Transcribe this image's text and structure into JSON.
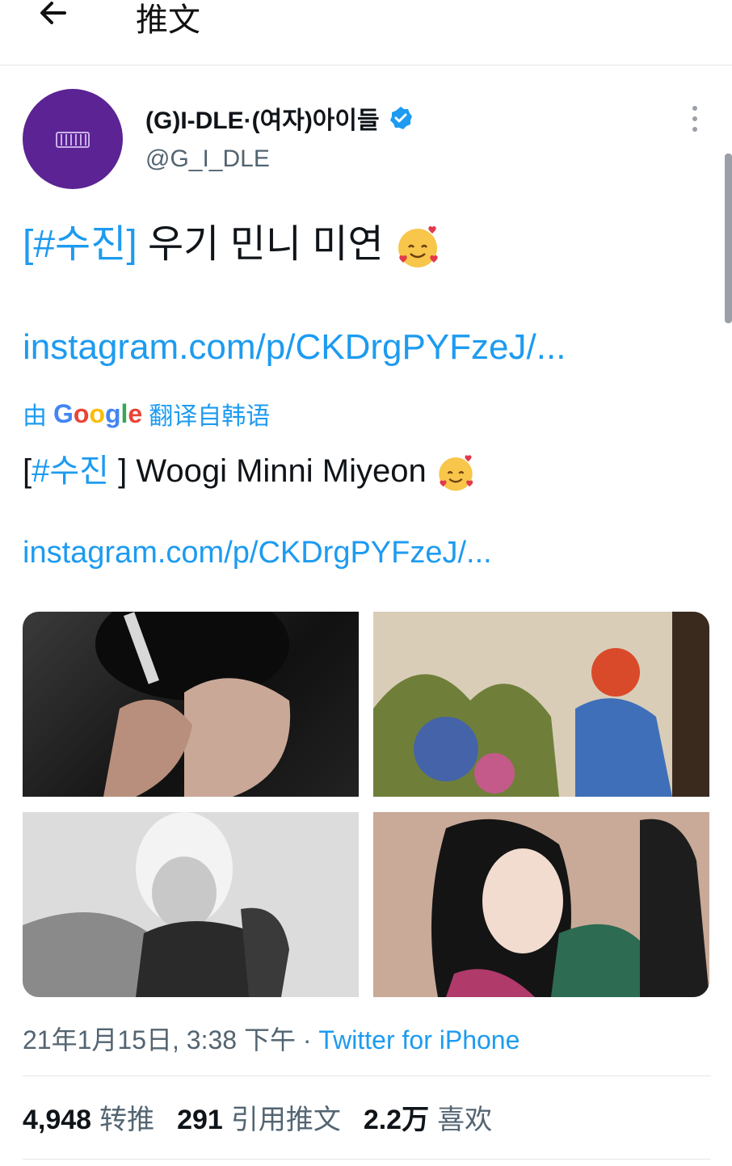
{
  "header": {
    "title": "推文"
  },
  "author": {
    "name": "(G)I-DLE·(여자)아이들",
    "handle": "@G_I_DLE",
    "avatar_logo": "i-dle-logo"
  },
  "tweet": {
    "text_hashtag": "[#수진]",
    "text_body": " 우기 민니 미연",
    "link": "instagram.com/p/CKDrgPYFzeJ/...",
    "emoji": "smiling-face-with-hearts"
  },
  "translation": {
    "prefix": "由",
    "google": [
      "G",
      "o",
      "o",
      "g",
      "l",
      "e"
    ],
    "suffix": "翻译自韩语",
    "text_open": "[",
    "text_hashtag": "#수진",
    "text_body": " ] Woogi Minni Miyeon ",
    "link": "instagram.com/p/CKDrgPYFzeJ/..."
  },
  "meta": {
    "timestamp": "21年1月15日, 3:38 下午",
    "separator": " · ",
    "source": "Twitter for iPhone"
  },
  "stats": {
    "retweets_count": "4,948",
    "retweets_label": "转推",
    "quotes_count": "291",
    "quotes_label": "引用推文",
    "likes_count": "2.2万",
    "likes_label": "喜欢"
  },
  "colors": {
    "accent": "#1d9bf0",
    "avatar": "#5b2394",
    "text": "#0f1419",
    "secondary": "#536471"
  }
}
